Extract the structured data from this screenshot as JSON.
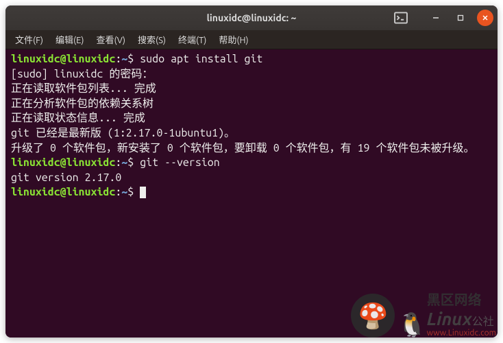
{
  "window": {
    "title": "linuxidc@linuxidc: ~"
  },
  "menubar": [
    {
      "label": "文件(F)"
    },
    {
      "label": "编辑(E)"
    },
    {
      "label": "查看(V)"
    },
    {
      "label": "搜索(S)"
    },
    {
      "label": "终端(T)"
    },
    {
      "label": "帮助(H)"
    }
  ],
  "prompt": {
    "user_host": "linuxidc@linuxidc",
    "colon": ":",
    "path": "~",
    "dollar": "$ "
  },
  "terminal": {
    "cmd1": "sudo apt install git",
    "line2": "[sudo] linuxidc 的密码：",
    "line3": "正在读取软件包列表... 完成",
    "line4": "正在分析软件包的依赖关系树       ",
    "line5": "正在读取状态信息... 完成       ",
    "line6": "git 已经是最新版 (1:2.17.0-1ubuntu1)。",
    "line7": "升级了 0 个软件包，新安装了 0 个软件包，要卸载 0 个软件包，有 19 个软件包未被升级。",
    "cmd2": "git --version",
    "line9": "git version 2.17.0"
  },
  "watermark": {
    "brand_cn": "黑区网络",
    "brand_en": "Linux",
    "brand_suffix": "公社",
    "url": "www.Linuxidc.com",
    "mushroom": "🍄",
    "tux": "🐧"
  }
}
